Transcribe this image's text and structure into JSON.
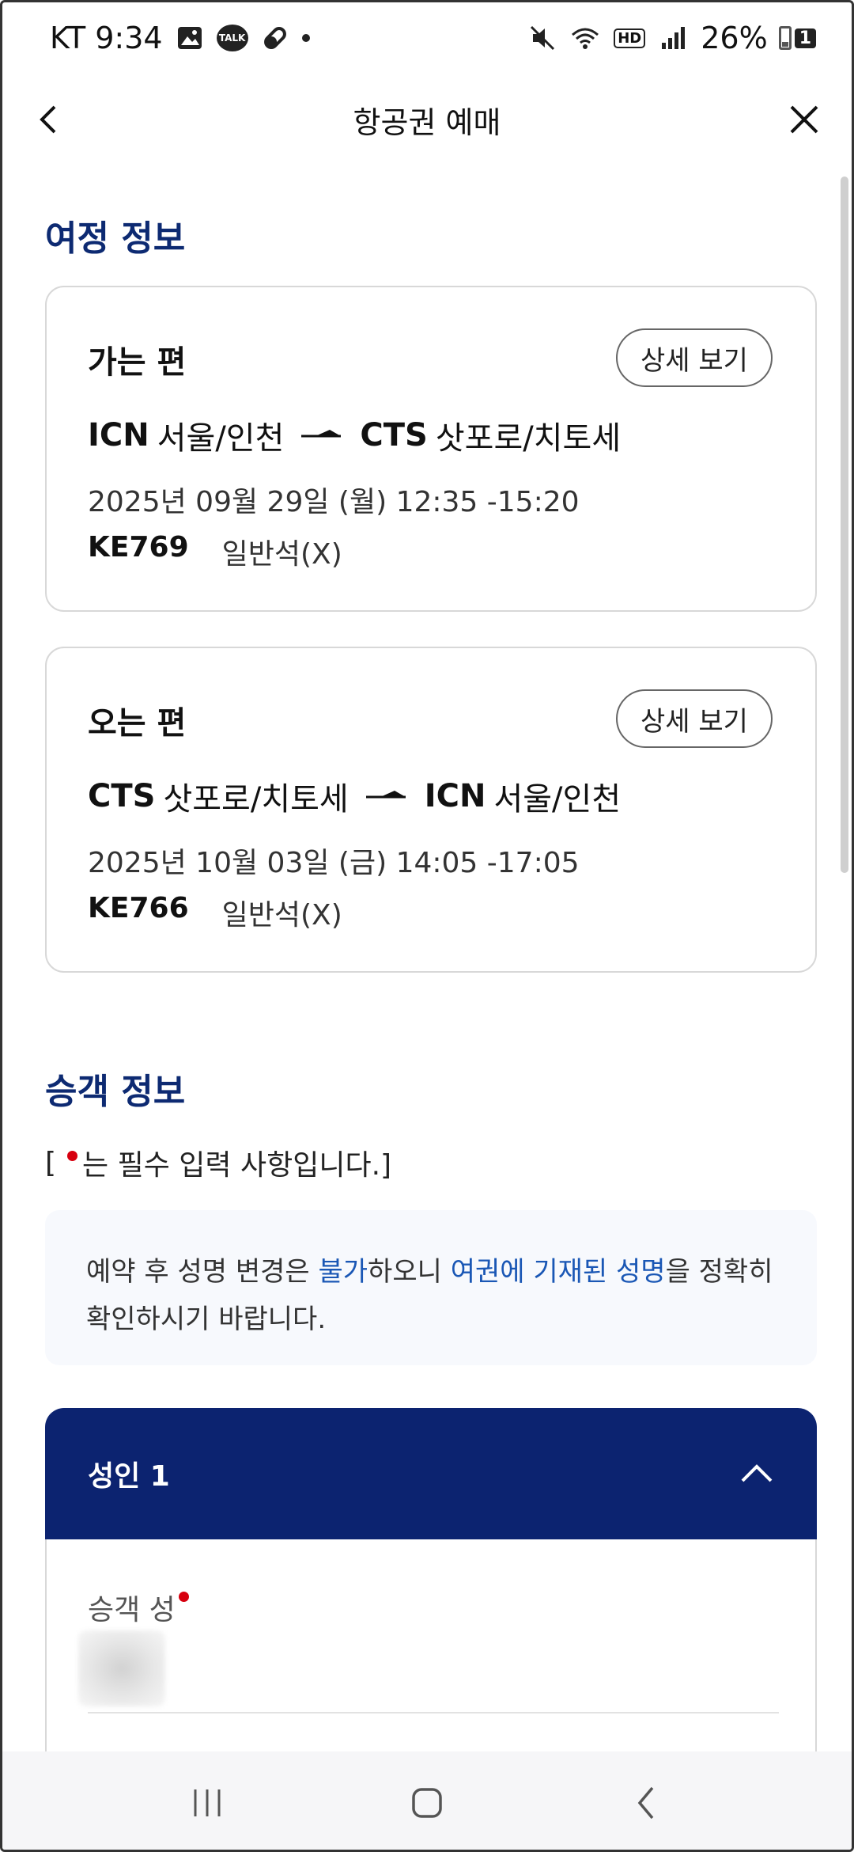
{
  "status_bar": {
    "carrier_time": "KT 9:34",
    "battery": "26%",
    "sim_badge": "1",
    "icons": [
      "image-icon",
      "kakaotalk-icon",
      "pill-icon",
      "notification-dot",
      "mute-icon",
      "wifi-icon",
      "hd-icon",
      "signal-icon",
      "battery-icon"
    ],
    "talk_label": "TALK",
    "hd_label": "HD"
  },
  "header": {
    "title": "항공권 예매",
    "back_icon": "chevron-left-icon",
    "close_icon": "close-icon"
  },
  "itinerary": {
    "section_title": "여정 정보",
    "outbound": {
      "leg_label": "가는 편",
      "detail_button": "상세 보기",
      "from_code": "ICN",
      "from_city": "서울/인천",
      "to_code": "CTS",
      "to_city": "삿포로/치토세",
      "datetime": "2025년 09월 29일 (월) 12:35 -15:20",
      "flight_no": "KE769",
      "cabin": "일반석(X)"
    },
    "inbound": {
      "leg_label": "오는 편",
      "detail_button": "상세 보기",
      "from_code": "CTS",
      "from_city": "삿포로/치토세",
      "to_code": "ICN",
      "to_city": "서울/인천",
      "datetime": "2025년 10월 03일 (금) 14:05 -17:05",
      "flight_no": "KE766",
      "cabin": "일반석(X)"
    }
  },
  "passenger": {
    "section_title": "승객 정보",
    "required_note_prefix": "[",
    "required_note_text": "는 필수 입력 사항입니다.]",
    "notice": {
      "part1": "예약 후 성명 변경은 ",
      "hl1": "불가",
      "part2": "하오니 ",
      "hl2": "여권에 기재된 성명",
      "part3": "을 정확히 확인하시기 바랍니다."
    },
    "accordion_label": "성인 1",
    "surname_label": "승객 성"
  },
  "colors": {
    "accent_navy": "#0c2370",
    "section_title": "#0d2a72",
    "highlight_blue": "#1a57b5",
    "required_red": "#d7000f"
  }
}
